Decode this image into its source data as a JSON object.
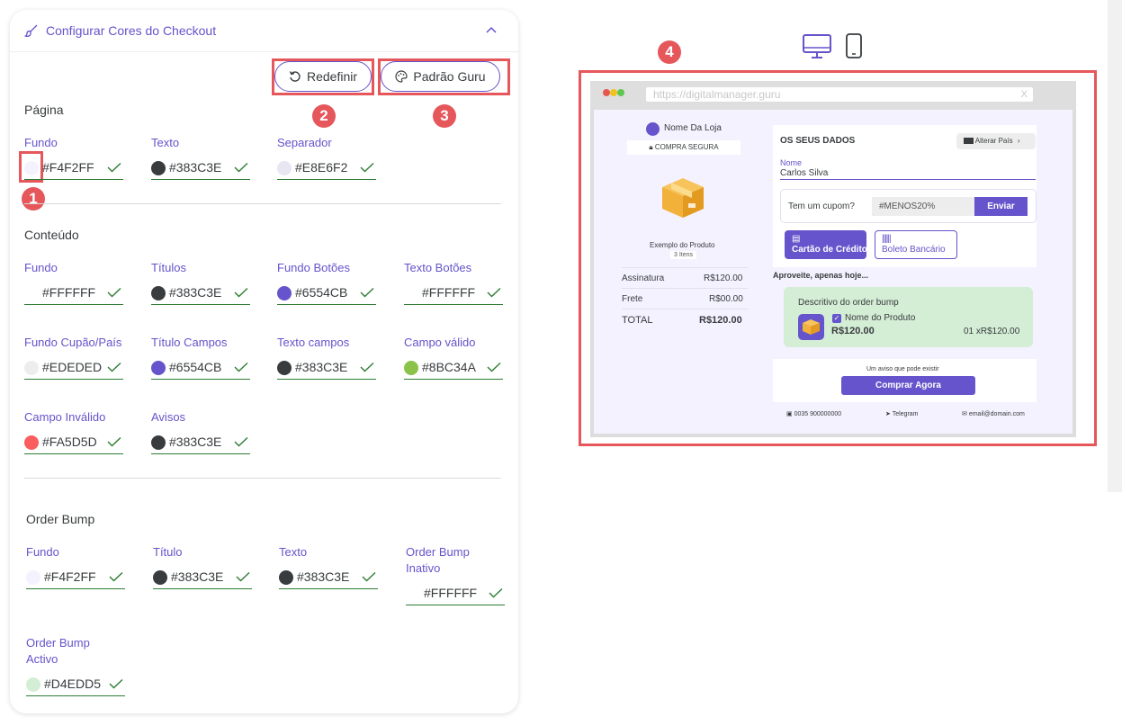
{
  "header": {
    "title": "Configurar Cores do Checkout"
  },
  "actions": {
    "reset_label": "Redefinir",
    "default_label": "Padrão Guru"
  },
  "badges": {
    "one": "1",
    "two": "2",
    "three": "3",
    "four": "4"
  },
  "sections": {
    "pagina": {
      "title": "Página",
      "fields": [
        {
          "label": "Fundo",
          "value": "#F4F2FF",
          "color": "#F4F2FF"
        },
        {
          "label": "Texto",
          "value": "#383C3E",
          "color": "#383C3E"
        },
        {
          "label": "Separador",
          "value": "#E8E6F2",
          "color": "#E8E6F2"
        }
      ]
    },
    "conteudo": {
      "title": "Conteúdo",
      "fields": [
        {
          "label": "Fundo",
          "value": "#FFFFFF",
          "color": "#FFFFFF"
        },
        {
          "label": "Títulos",
          "value": "#383C3E",
          "color": "#383C3E"
        },
        {
          "label": "Fundo Botões",
          "value": "#6554CB",
          "color": "#6554CB"
        },
        {
          "label": "Texto Botões",
          "value": "#FFFFFF",
          "color": "#FFFFFF"
        },
        {
          "label": "Fundo Cupão/País",
          "value": "#EDEDED",
          "color": "#EDEDED"
        },
        {
          "label": "Título Campos",
          "value": "#6554CB",
          "color": "#6554CB"
        },
        {
          "label": "Texto campos",
          "value": "#383C3E",
          "color": "#383C3E"
        },
        {
          "label": "Campo válido",
          "value": "#8BC34A",
          "color": "#8BC34A"
        },
        {
          "label": "Campo Inválido",
          "value": "#FA5D5D",
          "color": "#FA5D5D"
        },
        {
          "label": "Avisos",
          "value": "#383C3E",
          "color": "#383C3E"
        }
      ]
    },
    "order_bump": {
      "title": "Order Bump",
      "fields": [
        {
          "label": "Fundo",
          "value": "#F4F2FF",
          "color": "#F4F2FF"
        },
        {
          "label": "Título",
          "value": "#383C3E",
          "color": "#383C3E"
        },
        {
          "label": "Texto",
          "value": "#383C3E",
          "color": "#383C3E"
        },
        {
          "label_line1": "Order Bump",
          "label_line2": "Inativo",
          "value": "#FFFFFF",
          "color": "#FFFFFF"
        },
        {
          "label_line1": "Order Bump",
          "label_line2": "Activo",
          "value": "#D4EDD5",
          "color": "#D4EDD5"
        }
      ]
    }
  },
  "preview": {
    "url": "https://digitalmanager.guru",
    "close": "X",
    "store_name": "Nome Da Loja",
    "secure": "COMPRA SEGURA",
    "product_name": "Exemplo do Produto",
    "items": "3 Itens",
    "summary": [
      {
        "label": "Assinatura",
        "value": "R$120.00"
      },
      {
        "label": "Frete",
        "value": "R$00.00"
      }
    ],
    "total_label": "TOTAL",
    "total_value": "R$120.00",
    "form_title": "OS SEUS DADOS",
    "change_country": "Alterar País",
    "name_label": "Nome",
    "name_value": "Carlos Silva",
    "coupon_q": "Tem um cupom?",
    "coupon_code": "#MENOS20%",
    "coupon_send": "Enviar",
    "pay_card": "Cartão de Crédito",
    "pay_boleto": "Boleto Bancário",
    "bump_heading": "Aproveite, apenas hoje...",
    "bump_desc": "Descritivo do order bump",
    "bump_product": "Nome do Produto",
    "bump_price": "R$120.00",
    "bump_qty_price": "01 xR$120.00",
    "notice": "Um aviso que pode existir",
    "buy_now": "Comprar Agora",
    "footer_phone": "0035 900000000",
    "footer_telegram": "Telegram",
    "footer_email": "email@domain.com"
  },
  "colors": {
    "accent": "#6554CB",
    "highlight": "#E5575B",
    "valid": "#2E7D32"
  }
}
